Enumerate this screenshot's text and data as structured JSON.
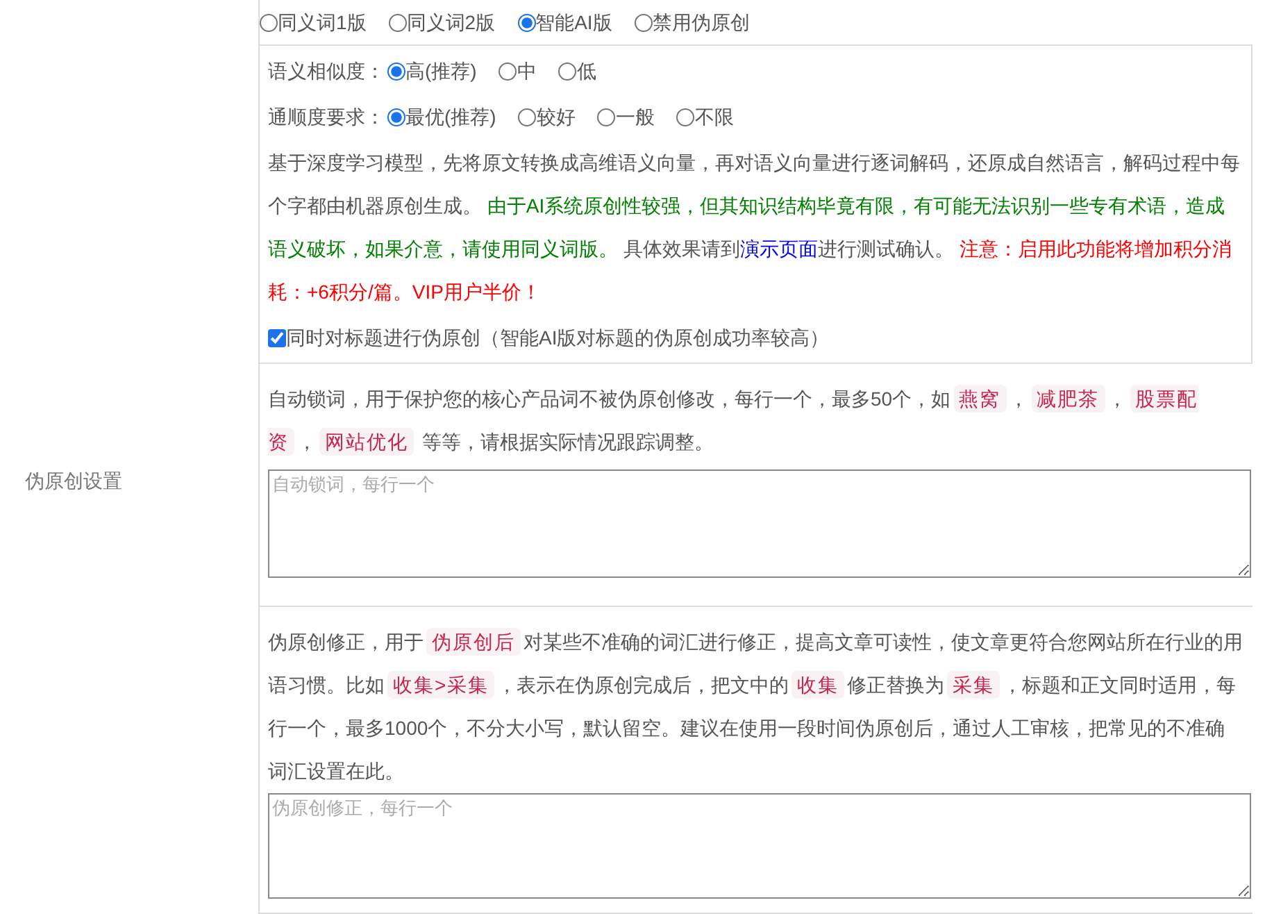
{
  "version_options": [
    {
      "label": "同义词1版",
      "selected": false
    },
    {
      "label": "同义词2版",
      "selected": false
    },
    {
      "label": "智能AI版",
      "selected": true
    },
    {
      "label": "禁用伪原创",
      "selected": false
    }
  ],
  "ai_settings": {
    "similarity": {
      "label": "语义相似度：",
      "options": [
        {
          "label": "高(推荐)",
          "selected": true
        },
        {
          "label": "中",
          "selected": false
        },
        {
          "label": "低",
          "selected": false
        }
      ]
    },
    "fluency": {
      "label": "通顺度要求：",
      "options": [
        {
          "label": "最优(推荐)",
          "selected": true
        },
        {
          "label": "较好",
          "selected": false
        },
        {
          "label": "一般",
          "selected": false
        },
        {
          "label": "不限",
          "selected": false
        }
      ]
    },
    "description": [
      {
        "kind": "plain",
        "text": "基于深度学习模型，先将原文转换成高维语义向量，再对语义向量进行逐词解码，还原成自然语言，解码过程中每个字都由机器原创生成。 "
      },
      {
        "kind": "notice",
        "text": "由于AI系统原创性较强，但其知识结构毕竟有限，有可能无法识别一些专有术语，造成语义破坏，如果介意，请使用同义词版。"
      },
      {
        "kind": "plain",
        "text": " 具体效果请到"
      },
      {
        "kind": "link",
        "text": "演示页面"
      },
      {
        "kind": "plain",
        "text": "进行测试确认。 "
      },
      {
        "kind": "warning",
        "text": "注意：启用此功能将增加积分消耗：+6积分/篇。VIP用户半价！"
      }
    ],
    "title_option": {
      "label": "同时对标题进行伪原创（智能AI版对标题的伪原创成功率较高）",
      "checked": true
    }
  },
  "side_label": "伪原创设置",
  "lock_words": {
    "description": [
      {
        "kind": "plain",
        "text": "自动锁词，用于保护您的核心产品词不被伪原创修改，每行一个，最多50个，如"
      },
      {
        "kind": "code",
        "text": "燕窝"
      },
      {
        "kind": "plain",
        "text": "，"
      },
      {
        "kind": "code",
        "text": "减肥茶"
      },
      {
        "kind": "plain",
        "text": "，"
      },
      {
        "kind": "code",
        "text": "股票配资"
      },
      {
        "kind": "plain",
        "text": "，"
      },
      {
        "kind": "code",
        "text": "网站优化"
      },
      {
        "kind": "plain",
        "text": " 等等，请根据实际情况跟踪调整。"
      }
    ],
    "textarea": {
      "placeholder": "自动锁词，每行一个"
    }
  },
  "correction": {
    "description": [
      {
        "kind": "plain",
        "text": "伪原创修正，用于"
      },
      {
        "kind": "code",
        "text": "伪原创后"
      },
      {
        "kind": "plain",
        "text": "对某些不准确的词汇进行修正，提高文章可读性，使文章更符合您网站所在行业的用语习惯。比如"
      },
      {
        "kind": "code",
        "text": "收集>采集"
      },
      {
        "kind": "plain",
        "text": "，表示在伪原创完成后，把文中的"
      },
      {
        "kind": "code",
        "text": "收集"
      },
      {
        "kind": "plain",
        "text": "修正替换为"
      },
      {
        "kind": "code",
        "text": "采集"
      },
      {
        "kind": "plain",
        "text": "，标题和正文同时适用，每行一个，最多1000个，不分大小写，默认留空。建议在使用一段时间伪原创后，通过人工审核，把常见的不准确词汇设置在此。"
      }
    ],
    "textarea": {
      "placeholder": "伪原创修正，每行一个"
    }
  }
}
